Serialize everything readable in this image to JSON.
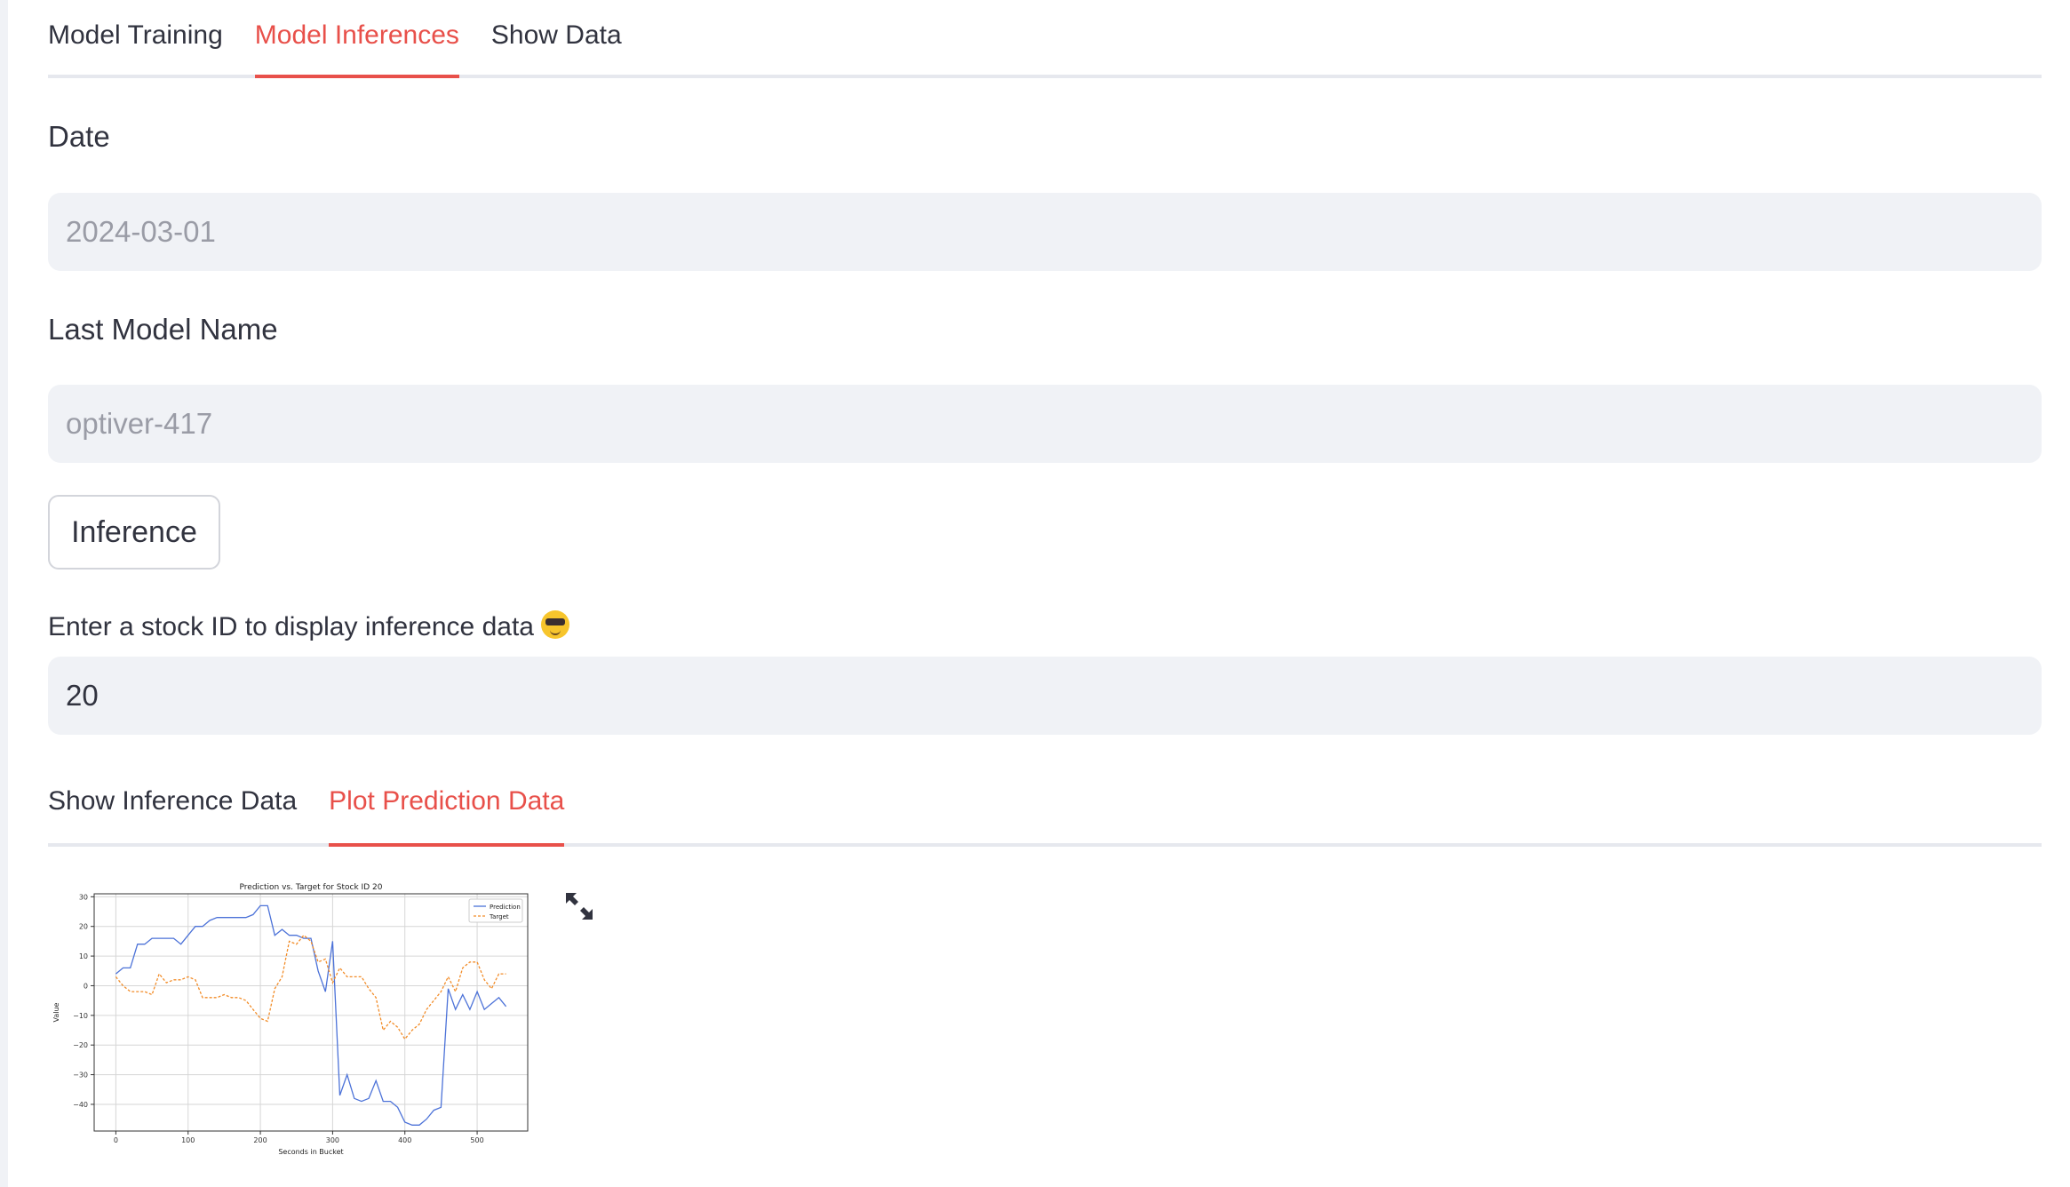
{
  "tabs": [
    {
      "label": "Model Training",
      "active": false
    },
    {
      "label": "Model Inferences",
      "active": true
    },
    {
      "label": "Show Data",
      "active": false
    }
  ],
  "form": {
    "date_label": "Date",
    "date_value": "2024-03-01",
    "model_label": "Last Model Name",
    "model_value": "optiver-417",
    "inference_button": "Inference",
    "stock_label": "Enter a stock ID to display inference data",
    "stock_emoji": "smiling-face-with-sunglasses",
    "stock_value": "20"
  },
  "subtabs": [
    {
      "label": "Show Inference Data",
      "active": false
    },
    {
      "label": "Plot Prediction Data",
      "active": true
    }
  ],
  "accent_color": "#e8504a",
  "fullscreen_icon": "expand-arrows-icon",
  "chart_data": {
    "type": "line",
    "title": "Prediction vs. Target for Stock ID 20",
    "xlabel": "Seconds in Bucket",
    "ylabel": "Value",
    "xlim": [
      -30,
      570
    ],
    "ylim": [
      -49,
      31
    ],
    "xticks": [
      0,
      100,
      200,
      300,
      400,
      500
    ],
    "yticks": [
      30,
      20,
      10,
      0,
      -10,
      -20,
      -30,
      -40
    ],
    "grid": true,
    "legend_position": "top-right",
    "x": [
      0,
      10,
      20,
      30,
      40,
      50,
      60,
      70,
      80,
      90,
      100,
      110,
      120,
      130,
      140,
      150,
      160,
      170,
      180,
      190,
      200,
      210,
      220,
      230,
      240,
      250,
      260,
      270,
      280,
      290,
      300,
      310,
      320,
      330,
      340,
      350,
      360,
      370,
      380,
      390,
      400,
      410,
      420,
      430,
      440,
      450,
      460,
      470,
      480,
      490,
      500,
      510,
      520,
      530,
      540
    ],
    "series": [
      {
        "name": "Prediction",
        "color": "#4c72d8",
        "dash": "solid",
        "values": [
          4,
          6,
          6,
          14,
          14,
          16,
          16,
          16,
          16,
          14,
          17,
          20,
          20,
          22,
          23,
          23,
          23,
          23,
          23,
          24,
          27,
          27,
          17,
          19,
          17,
          17,
          16,
          16,
          5,
          -2,
          15,
          -37,
          -30,
          -38,
          -39,
          -38,
          -32,
          -39,
          -39,
          -41,
          -46,
          -47,
          -47,
          -45,
          -42,
          -41,
          -1,
          -8,
          -3,
          -8,
          -2,
          -8,
          -6,
          -4,
          -7
        ]
      },
      {
        "name": "Target",
        "color": "#f28c28",
        "dash": "dashed",
        "values": [
          3,
          0,
          -2,
          -2,
          -2,
          -3,
          4,
          1,
          2,
          2,
          3,
          2,
          -4,
          -4,
          -4,
          -3,
          -4,
          -4,
          -5,
          -8,
          -11,
          -12,
          -1,
          3,
          15,
          14,
          17,
          15,
          8,
          9,
          1,
          6,
          3,
          3,
          3,
          -1,
          -4,
          -15,
          -12,
          -14,
          -18,
          -15,
          -13,
          -8,
          -5,
          -2,
          3,
          -2,
          6,
          8,
          8,
          2,
          -1,
          4,
          4
        ]
      }
    ]
  }
}
